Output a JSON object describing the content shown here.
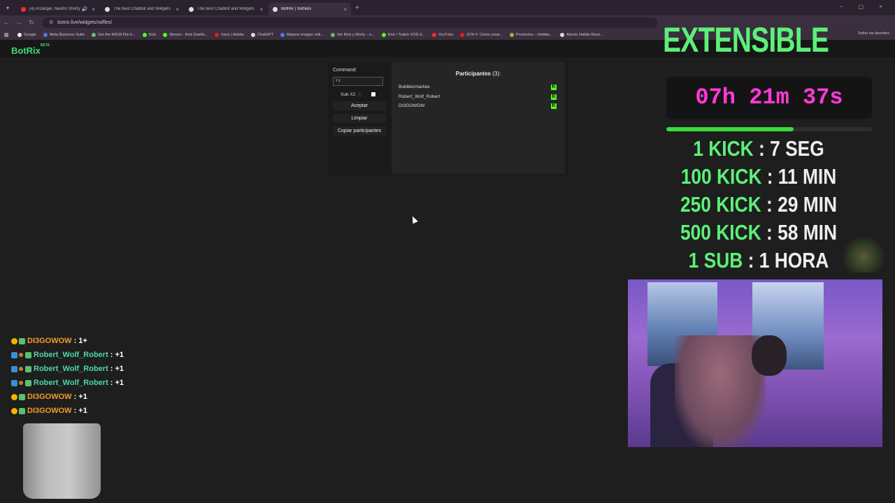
{
  "browser": {
    "tabs": [
      {
        "title": "(4) Arcangel, Neutro Shorty",
        "color": "#ff2a2a"
      },
      {
        "title": "The best ChatBot and Widgets",
        "color": "#dddddd"
      },
      {
        "title": "The best ChatBot and Widgets",
        "color": "#dddddd"
      },
      {
        "title": "BotRix | Sorteos",
        "color": "#dddddd"
      }
    ],
    "url": "botrix.live/widgets/raffles/",
    "bookmarks": [
      {
        "label": "Google",
        "color": "#eeeeee"
      },
      {
        "label": "Meta Business Suite",
        "color": "#4b7be0"
      },
      {
        "label": "Get the M3U8 File fr...",
        "color": "#5cc070"
      },
      {
        "label": "Kick",
        "color": "#53fc18"
      },
      {
        "label": "Stream - Kick Dashb...",
        "color": "#53fc18"
      },
      {
        "label": "Inicio | Adobe",
        "color": "#e02020"
      },
      {
        "label": "ChatGPT",
        "color": "#dddddd"
      },
      {
        "label": "Mejorar imagen onli...",
        "color": "#4b7be0"
      },
      {
        "label": "Ver Rick y Morty – o...",
        "color": "#5cc070"
      },
      {
        "label": "Kick / Twitch VOD d...",
        "color": "#53fc18"
      },
      {
        "label": "YouTube",
        "color": "#ff2a2a"
      },
      {
        "label": "GTA V: Cómo crear...",
        "color": "#e02020"
      },
      {
        "label": "Productos – Hobbie...",
        "color": "#80c040"
      },
      {
        "label": "Atomic Habits Reso...",
        "color": "#dddddd"
      }
    ],
    "bookmarks_all": "Todos los favoritos"
  },
  "site": {
    "logo": "BotRix",
    "logo_tag": "BETA"
  },
  "raffle": {
    "command_label": "Command:",
    "command_value": "+1",
    "sub_label": "Sub X2",
    "sub_info_icon": "info-icon",
    "accept_label": "Aceptar",
    "clear_label": "Limpiar",
    "copy_label": "Copiar participantes",
    "participants_title": "Participantes",
    "participants_count": "(3):",
    "participants": [
      {
        "name": "Bubblezmariiee"
      },
      {
        "name": "Robert_Wolf_Robert"
      },
      {
        "name": "DI3GOWOW"
      }
    ]
  },
  "overlay": {
    "title": "EXTENSIBLE",
    "timer": "07h 21m 37s",
    "timer_color": "#ff3ad8",
    "progress": 0.62,
    "accent": "#5cf078",
    "rates": [
      {
        "amount": "1 KICK",
        "sep": " : ",
        "time": "7 SEG"
      },
      {
        "amount": "100 KICK",
        "sep": " : ",
        "time": "11 MIN"
      },
      {
        "amount": "250 KICK",
        "sep": " : ",
        "time": "29 MIN"
      },
      {
        "amount": "500 KICK",
        "sep": " : ",
        "time": "58 MIN"
      },
      {
        "amount": "1 SUB",
        "sep": " : ",
        "time": "1 HORA"
      }
    ]
  },
  "chat": [
    {
      "user": "DI3GOWOW",
      "msg": ": 1+",
      "badges": [
        "gold",
        "green"
      ],
      "color": "orange"
    },
    {
      "user": "Robert_Wolf_Robert",
      "msg": ": +1",
      "badges": [
        "blue",
        "mini",
        "green"
      ],
      "color": "teal"
    },
    {
      "user": "Robert_Wolf_Robert",
      "msg": ": +1",
      "badges": [
        "blue",
        "mini",
        "green"
      ],
      "color": "teal"
    },
    {
      "user": "Robert_Wolf_Robert",
      "msg": ": +1",
      "badges": [
        "blue",
        "mini",
        "green"
      ],
      "color": "teal"
    },
    {
      "user": "DI3GOWOW",
      "msg": ": +1",
      "badges": [
        "gold",
        "green"
      ],
      "color": "orange"
    },
    {
      "user": "DI3GOWOW",
      "msg": ": +1",
      "badges": [
        "gold",
        "green"
      ],
      "color": "orange"
    }
  ]
}
